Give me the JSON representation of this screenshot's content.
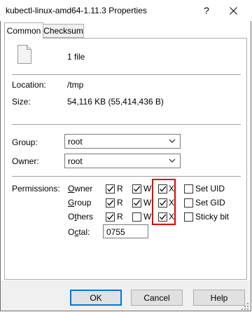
{
  "window": {
    "title": "kubectl-linux-amd64-1.11.3 Properties",
    "help_symbol": "?",
    "close_symbol": "×"
  },
  "tabs": [
    {
      "label": "Common",
      "active": true
    },
    {
      "label": "Checksum",
      "active": false
    }
  ],
  "file": {
    "icon": "file-icon",
    "count_text": "1 file"
  },
  "info": {
    "location_label": "Location:",
    "location_value": "/tmp",
    "size_label": "Size:",
    "size_value": "54,116 KB (55,414,436 B)"
  },
  "ownership": {
    "group_label": "Group:",
    "group_value": "root",
    "owner_label": "Owner:",
    "owner_value": "root"
  },
  "permissions": {
    "label": "Permissions:",
    "rows": [
      {
        "name": "Owner",
        "r": true,
        "w": true,
        "x": true,
        "special": "Set UID",
        "special_checked": false
      },
      {
        "name": "Group",
        "r": true,
        "w": true,
        "x": true,
        "special": "Set GID",
        "special_checked": false
      },
      {
        "name": "Others",
        "r": true,
        "w": false,
        "x": true,
        "special": "Sticky bit",
        "special_checked": false
      }
    ],
    "r_label": "R",
    "w_label": "W",
    "x_label": "X",
    "octal_label": "Octal:",
    "octal_value": "0755",
    "highlight_color": "#e00000"
  },
  "buttons": {
    "ok": "OK",
    "cancel": "Cancel",
    "help": "Help"
  }
}
